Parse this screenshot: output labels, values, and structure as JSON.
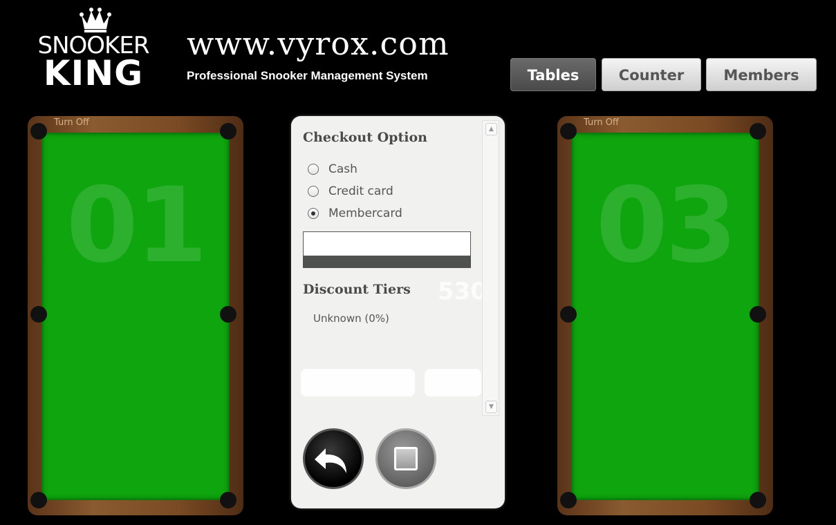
{
  "brand": {
    "logo_top": "SNOOKER",
    "logo_bottom": "KING",
    "site_url": "www.vyrox.com",
    "tagline": "Professional Snooker Management System"
  },
  "nav": {
    "tabs": [
      {
        "label": "Tables",
        "active": true
      },
      {
        "label": "Counter",
        "active": false
      },
      {
        "label": "Members",
        "active": false
      }
    ]
  },
  "tables": [
    {
      "number": "01",
      "status_label": "Turn Off"
    },
    {
      "number": "03",
      "status_label": "Turn Off"
    }
  ],
  "checkout": {
    "title": "Checkout Option",
    "payment_options": [
      {
        "label": "Cash",
        "selected": false
      },
      {
        "label": "Credit card",
        "selected": false
      },
      {
        "label": "Membercard",
        "selected": true
      }
    ],
    "card_number_value": "",
    "discount_title": "Discount Tiers",
    "discount_items": [
      "Unknown (0%)"
    ],
    "background_price": "530"
  },
  "colors": {
    "felt": "#0ea50e",
    "wood": "#7a4a24",
    "nav_active": "#5a5a5a",
    "panel": "#f1f1ef"
  },
  "icons": {
    "back": "undo-arrow-icon",
    "stop": "stop-square-icon",
    "crown": "crown-icon"
  }
}
